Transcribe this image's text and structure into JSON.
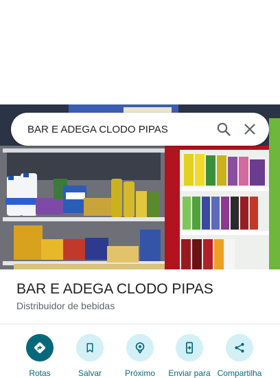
{
  "search": {
    "value": "BAR E ADEGA CLODO PIPAS"
  },
  "place": {
    "title": "BAR E ADEGA CLODO PIPAS",
    "category": "Distribuidor de bebidas"
  },
  "actions": [
    {
      "label": "Rotas",
      "icon": "directions-icon"
    },
    {
      "label": "Salvar",
      "icon": "bookmark-icon"
    },
    {
      "label": "Próximo",
      "icon": "nearby-icon"
    },
    {
      "label": "Enviar para",
      "icon": "send-to-phone-icon"
    },
    {
      "label": "Compartilha",
      "icon": "share-icon"
    }
  ],
  "colors": {
    "accent": "#06687b",
    "action_bg": "#d2f0f6",
    "title": "#202124",
    "subtitle": "#5f6368"
  }
}
